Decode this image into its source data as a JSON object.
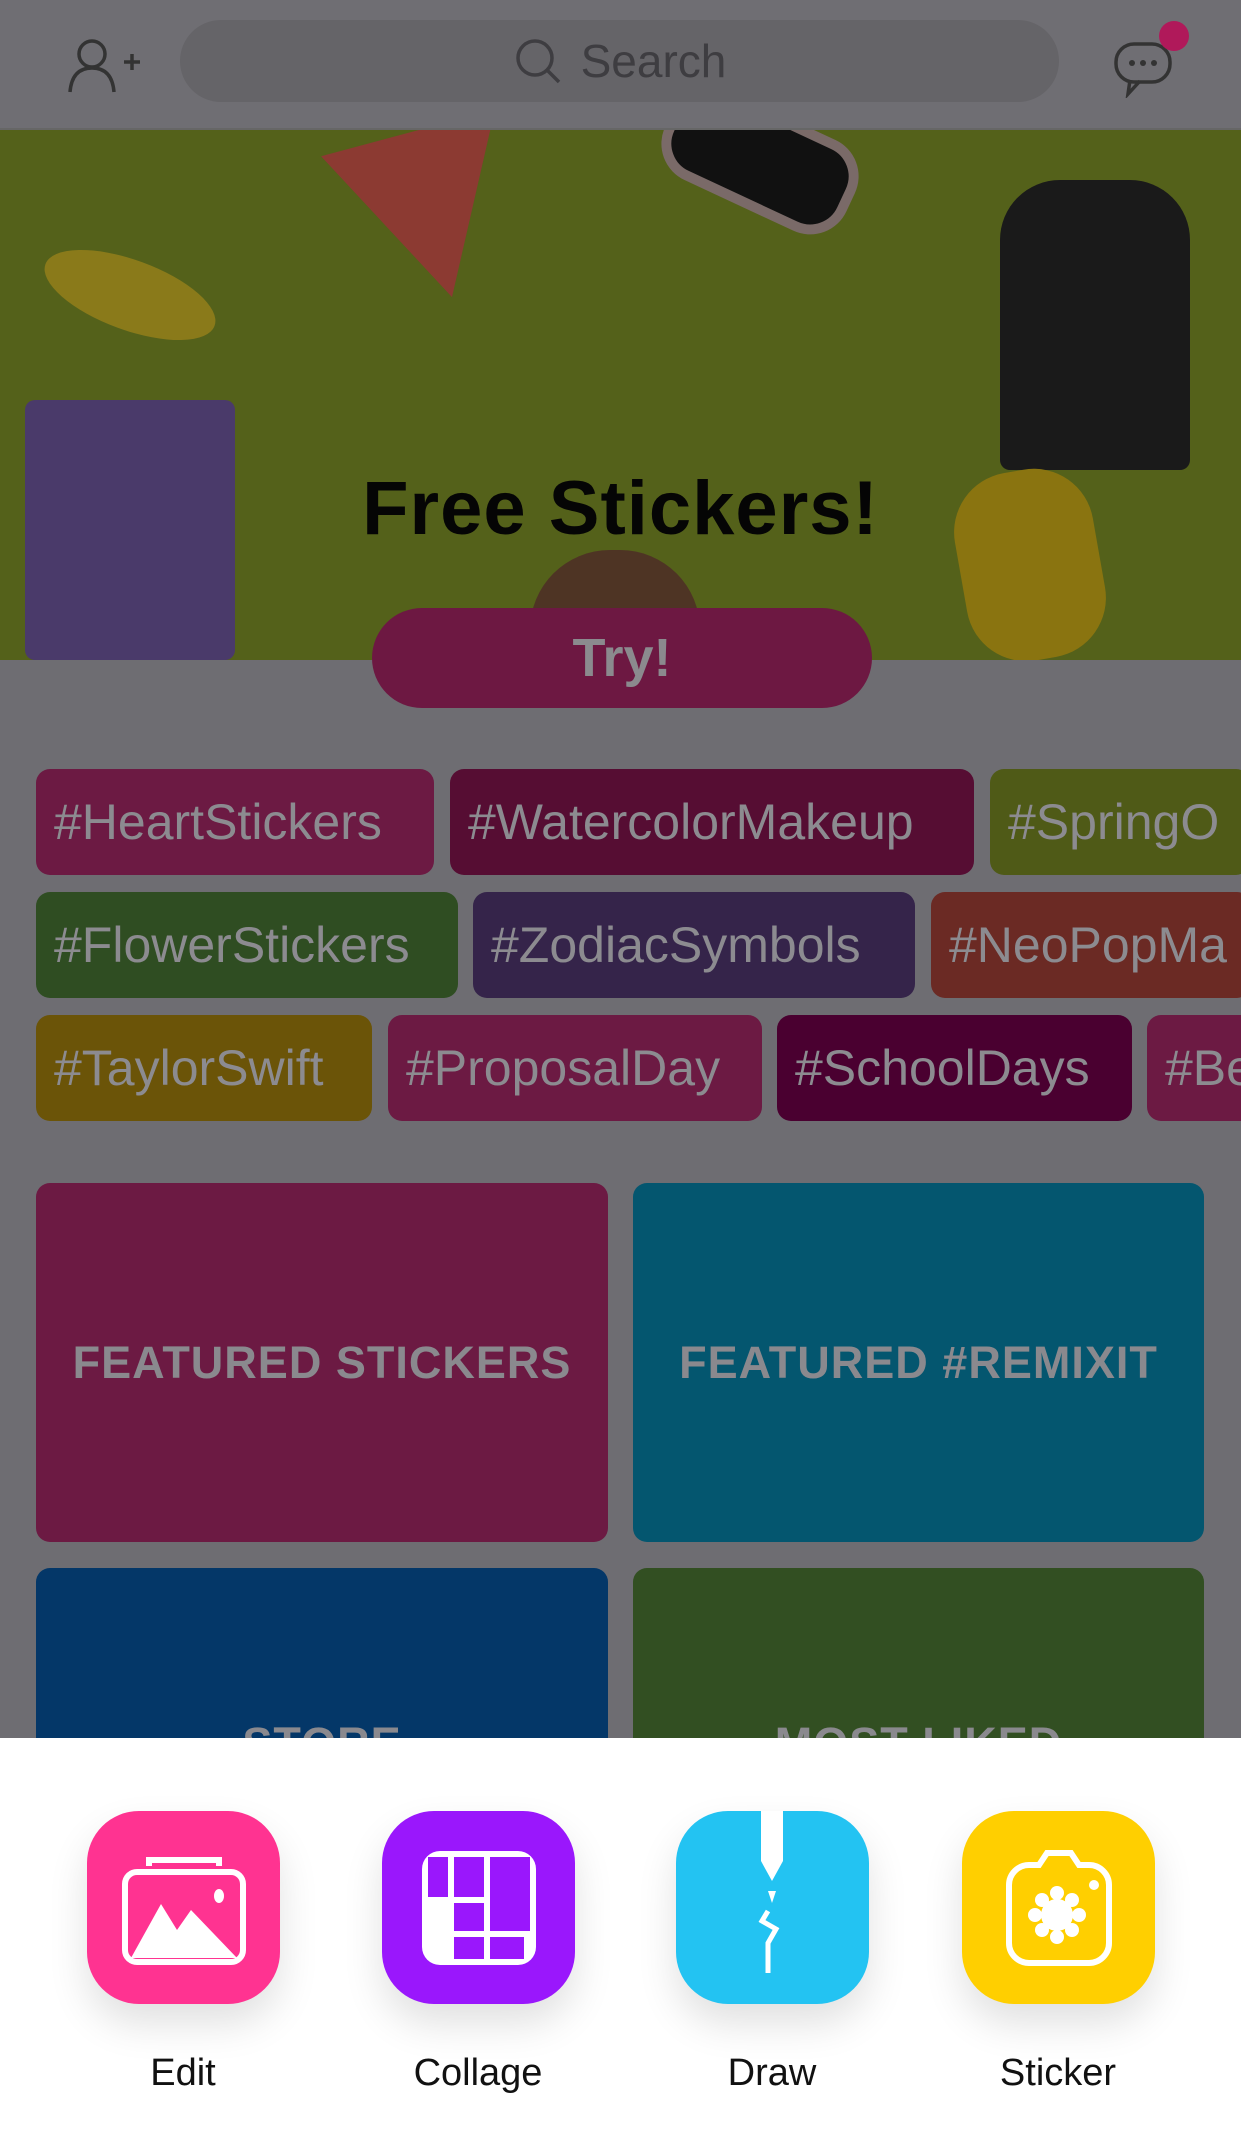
{
  "header": {
    "search_placeholder": "Search",
    "add_friend_icon": "person-plus-icon",
    "messages_icon": "chat-bubble-icon",
    "notification_color": "#c2185b"
  },
  "banner": {
    "title": "Free Stickers!",
    "cta": "Try!",
    "background": "#a6c234"
  },
  "tags": [
    {
      "label": "#HeartStickers",
      "color": "#6c1a43"
    },
    {
      "label": "#WatercolorMakeup",
      "color": "#560d33"
    },
    {
      "label": "#SpringO",
      "color": "#4f5a17"
    },
    {
      "label": "#FlowerStickers",
      "color": "#2f4d22"
    },
    {
      "label": "#ZodiacSymbols",
      "color": "#35244a"
    },
    {
      "label": "#NeoPopMa",
      "color": "#6b2a24"
    },
    {
      "label": "#TaylorSwift",
      "color": "#6b5408"
    },
    {
      "label": "#ProposalDay",
      "color": "#6c1a43"
    },
    {
      "label": "#SchoolDays",
      "color": "#4a0030"
    },
    {
      "label": "#Be",
      "color": "#6c1a43"
    }
  ],
  "tiles": [
    {
      "label": "FEATURED STICKERS",
      "color": "#6c1a43"
    },
    {
      "label": "FEATURED #REMIXIT",
      "color": "#04566f"
    },
    {
      "label": "STORE",
      "color": "#043768"
    },
    {
      "label": "MOST LIKED",
      "color": "#324f22"
    }
  ],
  "tools": [
    {
      "label": "Edit",
      "icon": "image-gallery-icon",
      "color": "#ff3391"
    },
    {
      "label": "Collage",
      "icon": "collage-grid-icon",
      "color": "#9a17fc"
    },
    {
      "label": "Draw",
      "icon": "pen-draw-icon",
      "color": "#23c3f2"
    },
    {
      "label": "Sticker",
      "icon": "sticker-camera-icon",
      "color": "#ffcf00"
    }
  ]
}
